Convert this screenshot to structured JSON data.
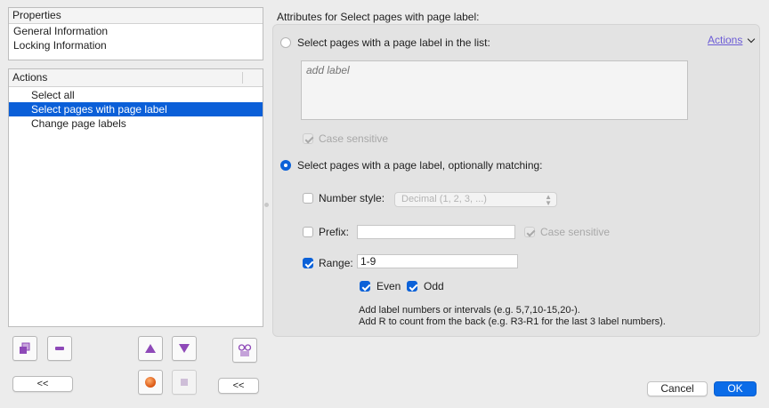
{
  "properties": {
    "header": "Properties",
    "items": [
      "General Information",
      "Locking Information"
    ]
  },
  "actions": {
    "header": "Actions",
    "items": [
      {
        "label": "Select all",
        "selected": false
      },
      {
        "label": "Select pages with page label",
        "selected": true
      },
      {
        "label": "Change page labels",
        "selected": false
      }
    ]
  },
  "toolbar": {
    "collapse_left_label": "<<",
    "collapse_right_label": "<<"
  },
  "attributes": {
    "title": "Attributes for Select pages with page label:",
    "actions_menu": "Actions",
    "option_list": {
      "label": "Select pages with a page label in the list:",
      "selected": false,
      "placeholder": "add label",
      "case_sensitive_label": "Case sensitive",
      "case_sensitive_checked": true
    },
    "option_match": {
      "label": "Select pages with a page label, optionally matching:",
      "selected": true,
      "number_style": {
        "label": "Number style:",
        "checked": false,
        "value": "Decimal (1, 2, 3, ...)"
      },
      "prefix": {
        "label": "Prefix:",
        "checked": false,
        "value": "",
        "case_sensitive_label": "Case sensitive",
        "case_sensitive_checked": true
      },
      "range": {
        "label": "Range:",
        "checked": true,
        "value": "1-9"
      },
      "even": {
        "label": "Even",
        "checked": true
      },
      "odd": {
        "label": "Odd",
        "checked": true
      },
      "help_line1": "Add label numbers or intervals (e.g. 5,7,10-15,20-).",
      "help_line2": "Add R to count from the back (e.g. R3-R1 for the last 3 label numbers)."
    }
  },
  "dialog": {
    "cancel_label": "Cancel",
    "ok_label": "OK"
  },
  "colors": {
    "accent": "#0b5fd8",
    "link": "#6b5bd6",
    "toolbar_icon": "#8e49b8",
    "record_icon": "#e0620a"
  }
}
